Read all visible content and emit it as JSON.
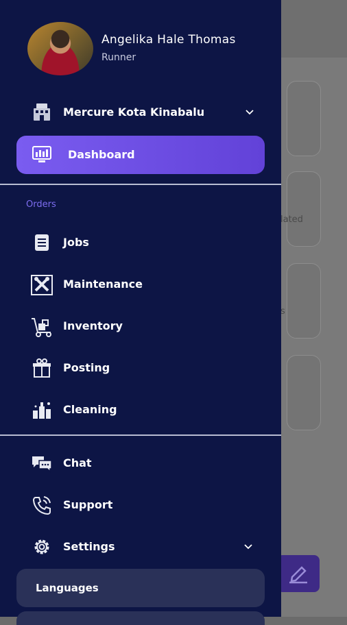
{
  "background": {
    "card_texts": [
      "",
      "lated",
      "s",
      ""
    ]
  },
  "profile": {
    "name": "Angelika Hale Thomas",
    "role": "Runner"
  },
  "property": {
    "label": "Mercure Kota Kinabalu"
  },
  "nav": {
    "dashboard": "Dashboard",
    "orders_section": "Orders",
    "orders": [
      "Jobs",
      "Maintenance",
      "Inventory",
      "Posting",
      "Cleaning"
    ],
    "chat": "Chat",
    "support": "Support",
    "settings": "Settings",
    "languages": "Languages"
  },
  "colors": {
    "drawer_bg": "#0d1545",
    "accent": "#7a5cf0",
    "section_label": "#7d6df0"
  }
}
